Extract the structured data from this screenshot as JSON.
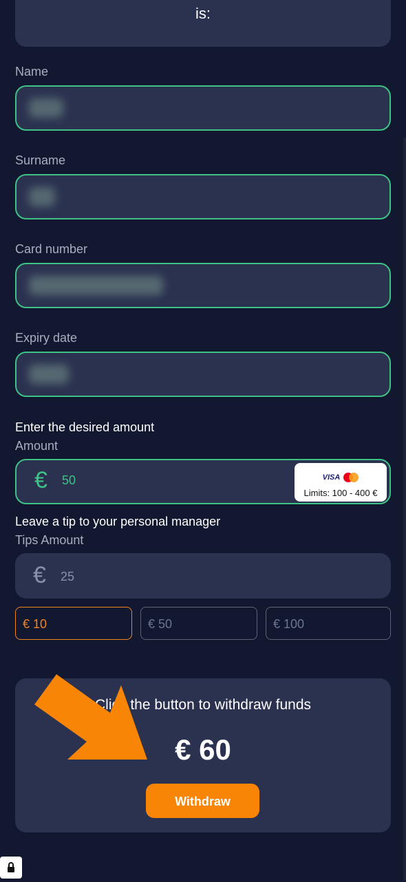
{
  "top_card": {
    "text": "is:"
  },
  "form": {
    "name_label": "Name",
    "surname_label": "Surname",
    "card_number_label": "Card number",
    "expiry_label": "Expiry date"
  },
  "amount": {
    "heading": "Enter the desired amount",
    "label": "Amount",
    "currency": "€",
    "value": "50",
    "limits": "Limits: 100 - 400 €",
    "visa": "VISA"
  },
  "tips": {
    "heading": "Leave a tip to your personal manager",
    "label": "Tips Amount",
    "currency": "€",
    "value": "25",
    "options": [
      "€ 10",
      "€ 50",
      "€ 100"
    ]
  },
  "withdraw": {
    "message": "Click the button to withdraw funds",
    "total": "€ 60",
    "button": "Withdraw"
  },
  "colors": {
    "background": "#121830",
    "card": "#2b3250",
    "accent_green": "#3ec285",
    "accent_orange": "#f98506"
  },
  "icons": [
    "euro-icon",
    "visa-logo",
    "mastercard-logo",
    "arrow-icon",
    "lock-icon"
  ]
}
